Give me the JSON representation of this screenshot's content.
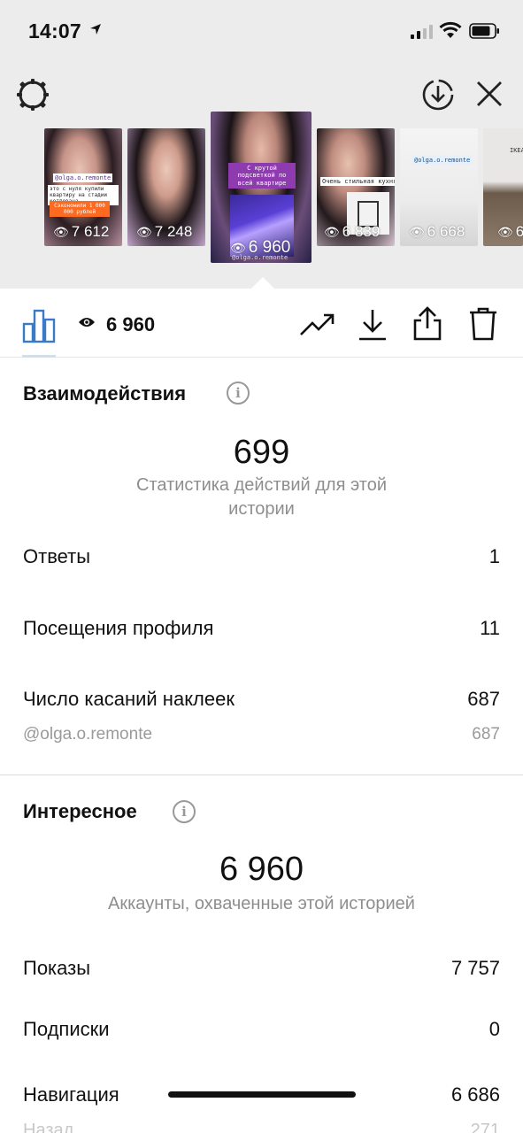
{
  "status_bar": {
    "time": "14:07"
  },
  "stories": [
    {
      "views": "7 612",
      "tag_handle": "@olga.o.remonte",
      "tag_text": "это с нуля купили квартиру на стадии котлована",
      "tag_orange": "Сэкономили 1 000 000 рублей"
    },
    {
      "views": "7 248"
    },
    {
      "views": "6 960",
      "tag_text": "С крутой подсветкой по всей квартире",
      "tag_handle": "@olga.o.remonte"
    },
    {
      "views": "6 839",
      "tag_text": "Очень стильная кухня ♥"
    },
    {
      "views": "6 668",
      "tag_handle": "@olga.o.remonte"
    },
    {
      "views": "6",
      "tag_text": "IKEA"
    }
  ],
  "toolbar": {
    "view_count": "6 960"
  },
  "interactions": {
    "title": "Взаимодействия",
    "total": "699",
    "subtitle": "Статистика действий для этой истории",
    "rows": [
      {
        "label": "Ответы",
        "value": "1"
      },
      {
        "label": "Посещения профиля",
        "value": "11"
      },
      {
        "label": "Число касаний наклеек",
        "value": "687"
      }
    ],
    "sub_row": {
      "label": "@olga.o.remonte",
      "value": "687"
    }
  },
  "discovery": {
    "title": "Интересное",
    "total": "6 960",
    "subtitle": "Аккаунты, охваченные этой историей",
    "rows": [
      {
        "label": "Показы",
        "value": "7 757"
      },
      {
        "label": "Подписки",
        "value": "0"
      },
      {
        "label": "Навигация",
        "value": "6 686"
      }
    ],
    "partial_row": {
      "label": "Назад",
      "value": "271"
    }
  }
}
